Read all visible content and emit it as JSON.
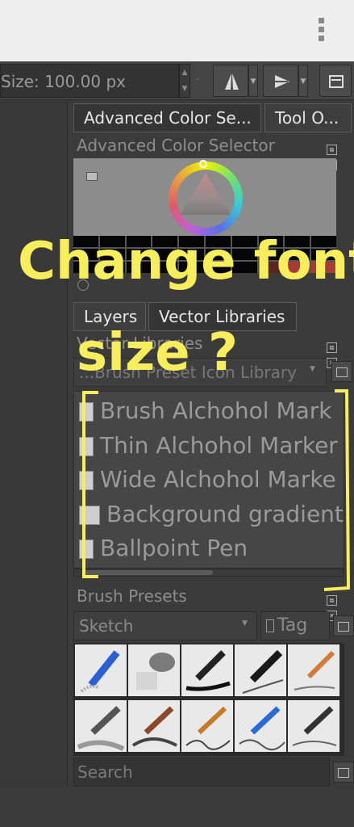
{
  "toolbar": {
    "size_label": "Size: 100.00 px"
  },
  "dockers": {
    "top_tabs": [
      "Advanced Color Se...",
      "Tool O..."
    ],
    "color_selector_title": "Advanced Color Selector",
    "mid_tabs": [
      "Layers",
      "Vector Libraries"
    ],
    "vector_libraries_title": "Vector Libraries",
    "vector_library_selected": "...Brush Preset Icon Library",
    "vector_items": [
      "Brush Alchohol Mark",
      "Thin Alchohol Marker",
      "Wide Alchohol Marke",
      "Background gradient",
      "Ballpoint Pen"
    ],
    "brush_presets_title": "Brush Presets",
    "brush_tag_selected": "Sketch",
    "tag_button": "Tag",
    "search_placeholder": "Search"
  },
  "annotation": {
    "line1": "Change font",
    "line2": "size ?"
  },
  "colors": {
    "background": "#3b3b3b",
    "annotation_ink": "#f6ee5a"
  }
}
